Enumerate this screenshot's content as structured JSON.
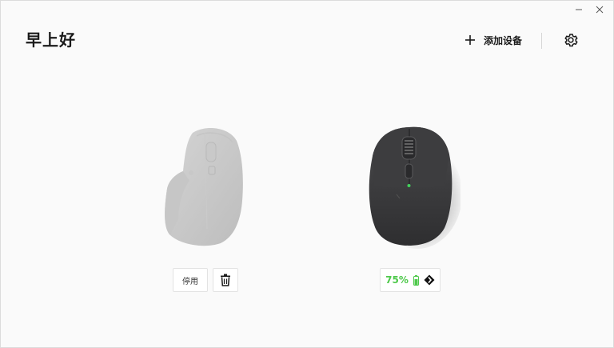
{
  "header": {
    "greeting": "早上好",
    "add_device_label": "添加设备",
    "add_device_icon": "plus-icon",
    "settings_icon": "gear-icon"
  },
  "window_controls": {
    "minimize_icon": "minimize-icon",
    "close_icon": "close-icon"
  },
  "devices": [
    {
      "state": "disabled",
      "image_icon": "mouse-mx-master-icon",
      "disable_label": "停用",
      "delete_icon": "trash-icon"
    },
    {
      "state": "connected",
      "image_icon": "mouse-mx-anywhere-icon",
      "battery": "75%",
      "battery_level": 0.75,
      "battery_icon": "battery-icon",
      "connection_icon": "unifying-receiver-icon"
    }
  ],
  "colors": {
    "battery_green": "#4fc94c",
    "background": "#fafafa"
  }
}
